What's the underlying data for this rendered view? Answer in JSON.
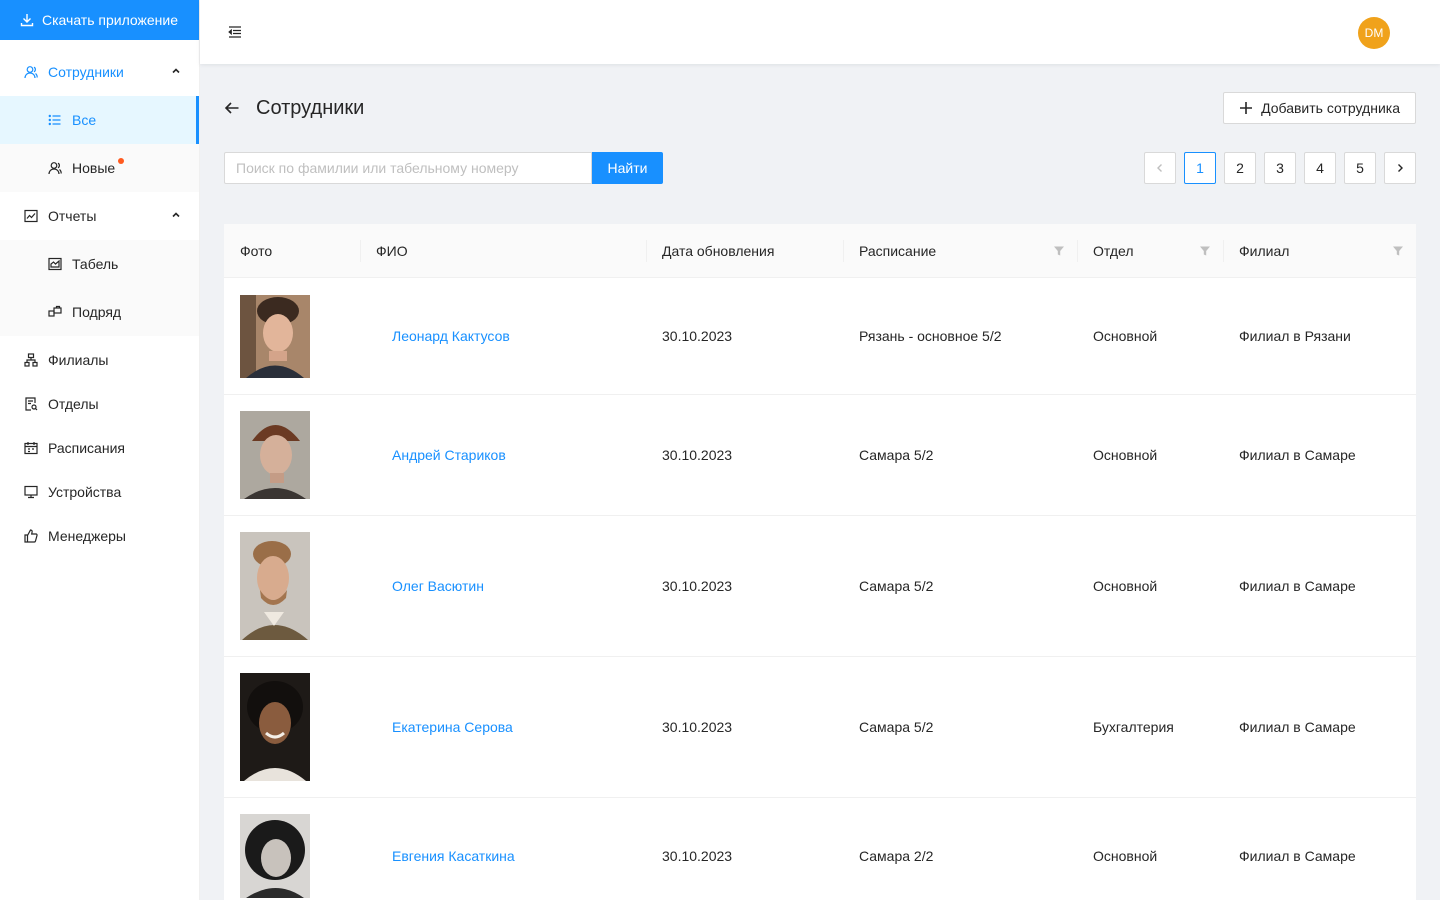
{
  "sidebar": {
    "download_label": "Скачать приложение",
    "items": [
      {
        "label": "Сотрудники"
      },
      {
        "label": "Все"
      },
      {
        "label": "Новые"
      },
      {
        "label": "Отчеты"
      },
      {
        "label": "Табель"
      },
      {
        "label": "Подряд"
      },
      {
        "label": "Филиалы"
      },
      {
        "label": "Отделы"
      },
      {
        "label": "Расписания"
      },
      {
        "label": "Устройства"
      },
      {
        "label": "Менеджеры"
      }
    ]
  },
  "header": {
    "avatar_initials": "DM"
  },
  "page": {
    "title": "Сотрудники",
    "add_button": "Добавить сотрудника",
    "search_placeholder": "Поиск по фамилии или табельному номеру",
    "search_button": "Найти",
    "pages": [
      "1",
      "2",
      "3",
      "4",
      "5"
    ],
    "current_page": "1"
  },
  "table": {
    "columns": [
      "Фото",
      "ФИО",
      "Дата обновления",
      "Расписание",
      "Отдел",
      "Филиал"
    ],
    "rows": [
      {
        "name": "Леонард Кактусов",
        "date": "30.10.2023",
        "schedule": "Рязань - основное 5/2",
        "department": "Основной",
        "branch": "Филиал в Рязани"
      },
      {
        "name": "Андрей Стариков",
        "date": "30.10.2023",
        "schedule": "Самара 5/2",
        "department": "Основной",
        "branch": "Филиал в Самаре"
      },
      {
        "name": "Олег Васютин",
        "date": "30.10.2023",
        "schedule": "Самара 5/2",
        "department": "Основной",
        "branch": "Филиал в Самаре"
      },
      {
        "name": "Екатерина Серова",
        "date": "30.10.2023",
        "schedule": "Самара 5/2",
        "department": "Бухгалтерия",
        "branch": "Филиал в Самаре"
      },
      {
        "name": "Евгения Касаткина",
        "date": "30.10.2023",
        "schedule": "Самара 2/2",
        "department": "Основной",
        "branch": "Филиал в Самаре"
      }
    ]
  },
  "colors": {
    "primary": "#1890ff",
    "avatar": "#f0a21b",
    "notification_dot": "#ff5a1f"
  }
}
